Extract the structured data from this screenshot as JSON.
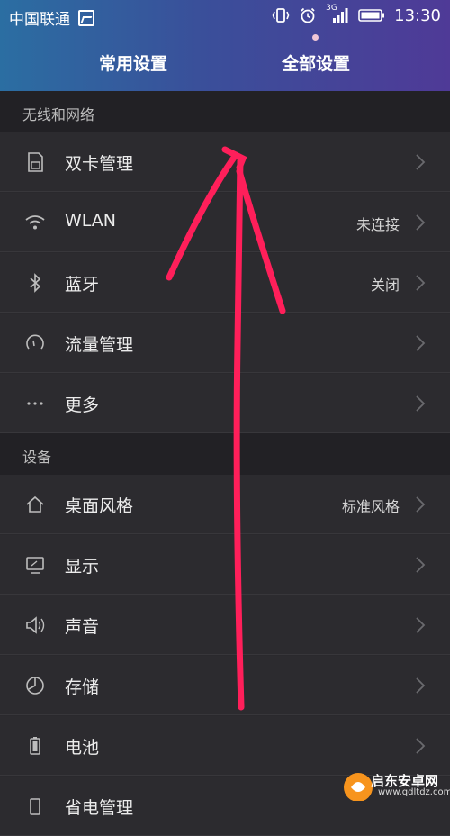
{
  "status": {
    "carrier": "中国联通",
    "network": "3G",
    "time": "13:30"
  },
  "tabs": [
    {
      "label": "常用设置"
    },
    {
      "label": "全部设置"
    }
  ],
  "sections": [
    {
      "title": "无线和网络"
    },
    {
      "title": "设备"
    }
  ],
  "rows": [
    {
      "label": "双卡管理",
      "value": "",
      "icon": "sim-card-icon"
    },
    {
      "label": "WLAN",
      "value": "未连接",
      "icon": "wifi-icon"
    },
    {
      "label": "蓝牙",
      "value": "关闭",
      "icon": "bluetooth-icon"
    },
    {
      "label": "流量管理",
      "value": "",
      "icon": "data-usage-icon"
    },
    {
      "label": "更多",
      "value": "",
      "icon": "more-icon"
    },
    {
      "label": "桌面风格",
      "value": "标准风格",
      "icon": "home-icon"
    },
    {
      "label": "显示",
      "value": "",
      "icon": "display-icon"
    },
    {
      "label": "声音",
      "value": "",
      "icon": "sound-icon"
    },
    {
      "label": "存储",
      "value": "",
      "icon": "storage-icon"
    },
    {
      "label": "电池",
      "value": "",
      "icon": "battery-icon"
    },
    {
      "label": "省电管理",
      "value": "",
      "icon": "power-saving-icon"
    }
  ],
  "watermark": {
    "line1": "启东安卓网",
    "line2": "www.qdltdz.com"
  },
  "colors": {
    "annotation": "#ff1f5a",
    "header_start": "#2b6ea2",
    "header_end": "#4f3a97"
  }
}
